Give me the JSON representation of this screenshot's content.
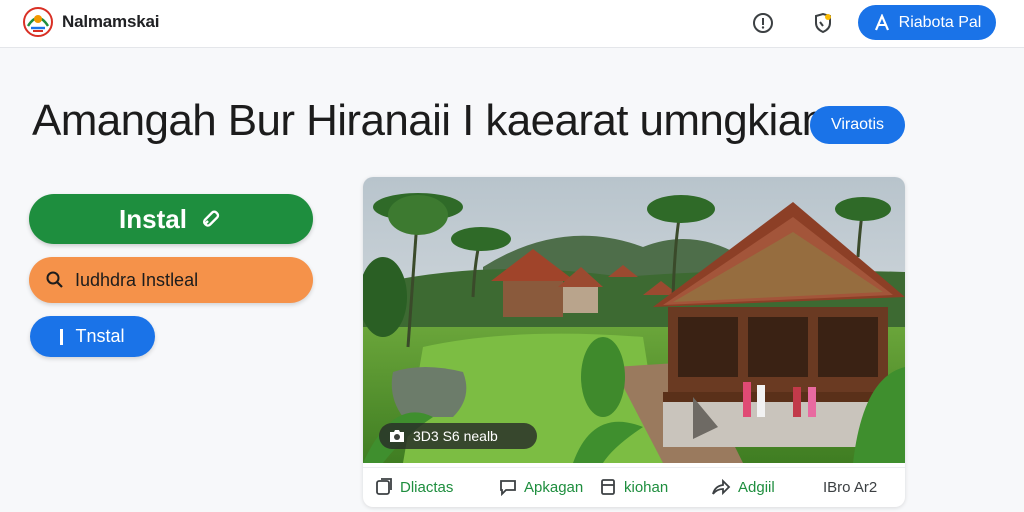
{
  "header": {
    "app_name": "Nalmamskai",
    "signin_label": "Riabota Pal",
    "icons": [
      "logo-icon",
      "info-icon",
      "shield-icon",
      "person-icon"
    ]
  },
  "hero": {
    "headline": "Amangah Bur Hiranaii I kaearat umngkian",
    "badge_label": "Viraotis"
  },
  "buttons": {
    "install_label": "Instal",
    "search_install_label": "Iudhdra Instleal",
    "small_install_label": "Tnstal"
  },
  "card": {
    "photo_chip": "3D3 S6 nealb",
    "actions": [
      {
        "label": "Dliactas",
        "icon": "photo-icon"
      },
      {
        "label": "Apkagan",
        "icon": "comment-icon"
      },
      {
        "label": "kiohan",
        "icon": "bookmark-icon"
      },
      {
        "label": "Adgiil",
        "icon": "share-icon"
      },
      {
        "label": "IBro Ar2",
        "icon": ""
      }
    ]
  },
  "colors": {
    "primary_blue": "#1a73e8",
    "install_green": "#1e8e3e",
    "accent_orange": "#f5924a",
    "action_green": "#1e8e3e"
  }
}
